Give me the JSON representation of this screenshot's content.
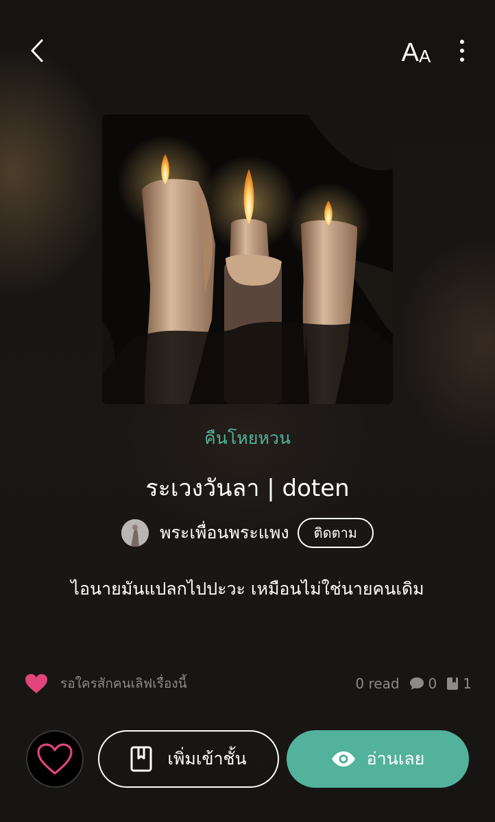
{
  "header": {
    "back_icon": "chevron-left-icon",
    "font_size_big": "A",
    "font_size_small": "A",
    "more_icon": "more-vertical-icon"
  },
  "story": {
    "genre": "คืนโหยหวน",
    "title": "ระเวงวันลา | doten",
    "author": "พระเพื่อนพระแพง",
    "follow_label": "ติดตาม",
    "description": "ไอนายมันแปลกไปปะวะ เหมือนไม่ใช่นายคนเดิม"
  },
  "stats": {
    "love_prompt": "รอใครสักคนเลิฟเรื่องนี้",
    "reads": "0 read",
    "comments": "0",
    "chapters": "1"
  },
  "actions": {
    "add_label": "เพิ่มเข้าชั้น",
    "read_label": "อ่านเลย"
  },
  "colors": {
    "accent": "#52b29c",
    "genre": "#4fb39c",
    "heart": "#e0457b",
    "muted": "#8d8a87"
  }
}
